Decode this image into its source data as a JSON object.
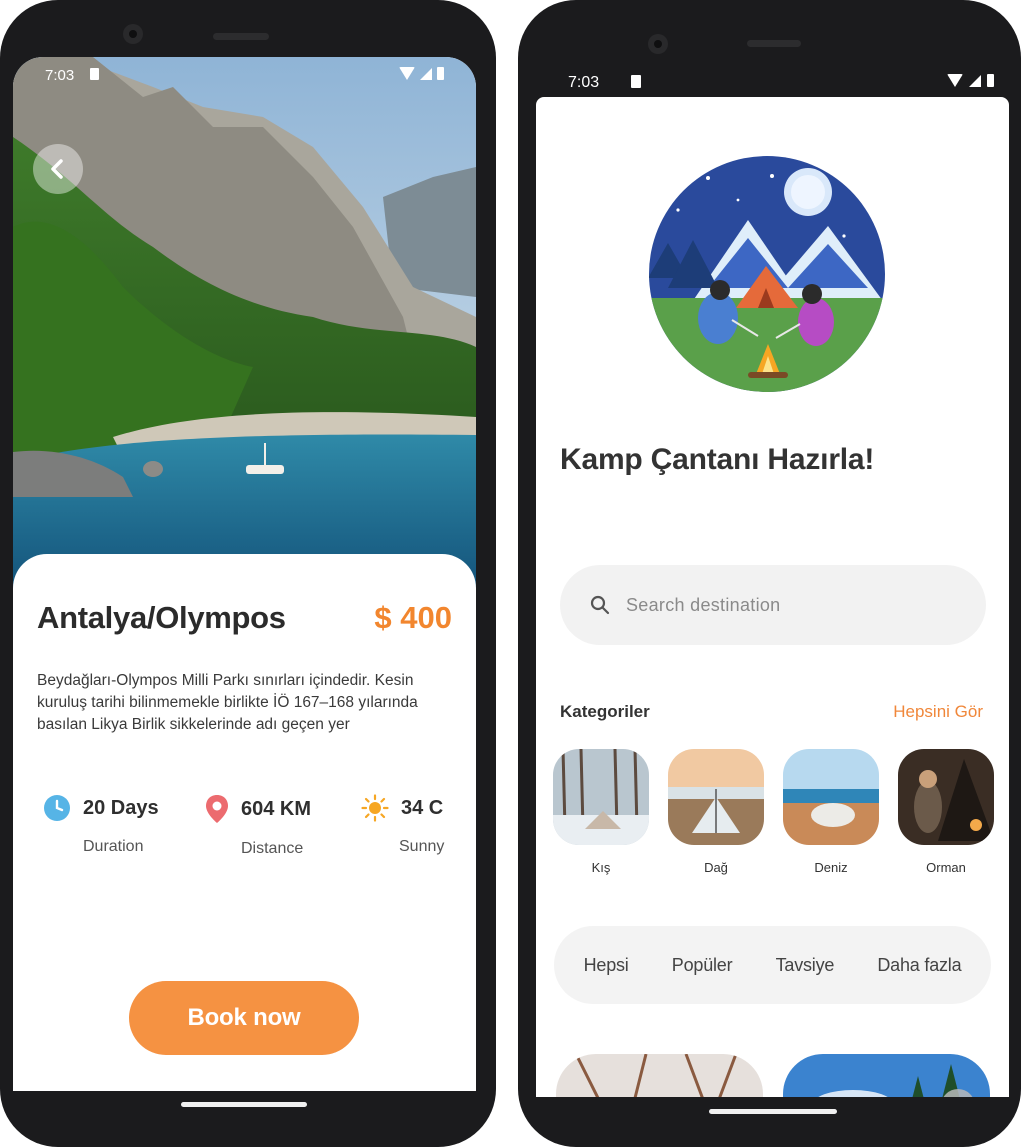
{
  "left_screen": {
    "status": {
      "time": "7:03"
    },
    "destination": {
      "name": "Antalya/Olympos",
      "price": "$ 400"
    },
    "description": "Beydağları-Olympos Milli Parkı sınırları içindedir. Kesin kuruluş tarihi bilinmemekle birlikte İÖ 167–168 yılarında basılan Likya Birlik sikkelerinde adı geçen yer",
    "stats": [
      {
        "icon": "clock-icon",
        "value": "20 Days",
        "label": "Duration"
      },
      {
        "icon": "location-pin-icon",
        "value": "604 KM",
        "label": "Distance"
      },
      {
        "icon": "sun-icon",
        "value": "34 C",
        "label": "Sunny"
      }
    ],
    "book_button": "Book now"
  },
  "right_screen": {
    "status": {
      "time": "7:03"
    },
    "title": "Kamp Çantanı Hazırla!",
    "search": {
      "placeholder": "Search destination",
      "value": ""
    },
    "categories": {
      "heading": "Kategoriler",
      "see_all": "Hepsini Gör",
      "items": [
        {
          "label": "Kış"
        },
        {
          "label": "Dağ"
        },
        {
          "label": "Deniz"
        },
        {
          "label": "Orman"
        }
      ]
    },
    "filters": [
      "Hepsi",
      "Popüler",
      "Tavsiye",
      "Daha fazla"
    ]
  },
  "colors": {
    "accent": "#f59242",
    "price": "#f2862e",
    "see_all": "#f0873a"
  }
}
